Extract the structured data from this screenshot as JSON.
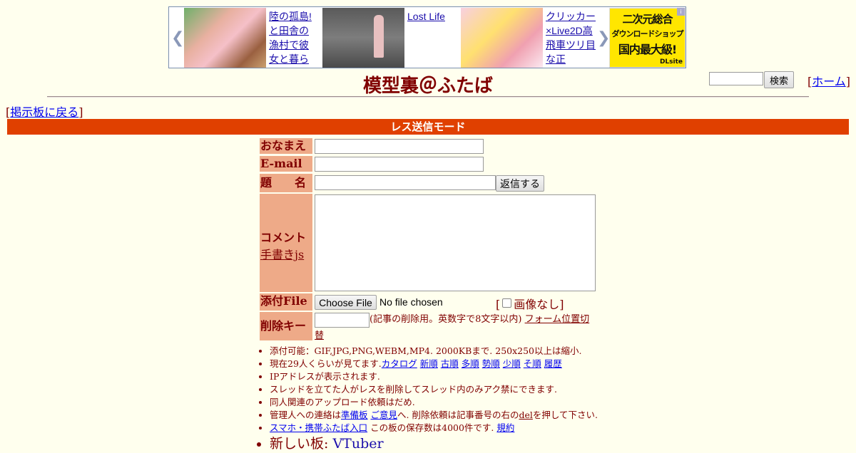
{
  "ad": {
    "item1": "陸の孤島!と田舎の漁村で彼女と暮ら",
    "item2": "Lost Life",
    "item3": "クリッカー×Live2D高飛車ツリ目な正",
    "dlsite_line1": "二次元総合",
    "dlsite_line2": "ダウンロードショップ",
    "dlsite_line3": "国内最大級!",
    "dlsite_brand": "DLsite",
    "info": "i"
  },
  "header": {
    "title": "模型裏＠ふたば",
    "search_button": "検索",
    "home_label": "ホーム",
    "back_label": "掲示板に戻る"
  },
  "mode_bar": "レス送信モード",
  "form": {
    "name_label": "おなまえ",
    "email_label": "E-mail",
    "subject_label": "題　　名",
    "submit_label": "返信する",
    "comment_label": "コメント",
    "handwrite_link": "手書きjs",
    "file_label": "添付File",
    "choose_file": "Choose File",
    "no_file": "No file chosen",
    "no_image": "画像なし",
    "delkey_label": "削除キー",
    "delkey_note": "(記事の削除用。英数字で8文字以内)",
    "form_toggle_a": "フォーム位置切",
    "form_toggle_b": "替"
  },
  "notes": {
    "n1": "添付可能：GIF,JPG,PNG,WEBM,MP4. 2000KBまで. 250x250以上は縮小.",
    "n2_prefix": "現在29人くらいが見てます.",
    "n2_links": [
      "カタログ",
      "新順",
      "古順",
      "多順",
      "勢順",
      "少順",
      "そ順",
      "履歴"
    ],
    "n3": "IPアドレスが表示されます.",
    "n4": "スレッドを立てた人がレスを削除してスレッド内のみアク禁にできます.",
    "n5": "同人関連のアップロード依頼はだめ.",
    "n6_a": "管理人への連絡は",
    "n6_link1": "準備板",
    "n6_link2": "ご意見",
    "n6_b": "へ. 削除依頼は記事番号の右の",
    "n6_del": "del",
    "n6_c": "を押して下さい.",
    "n7_link": "スマホ・携帯ふたば入口",
    "n7_text": "この板の保存数は4000件です.",
    "n7_link2": "規約",
    "n8_prefix": "新しい板:",
    "n8_link": "VTuber"
  }
}
